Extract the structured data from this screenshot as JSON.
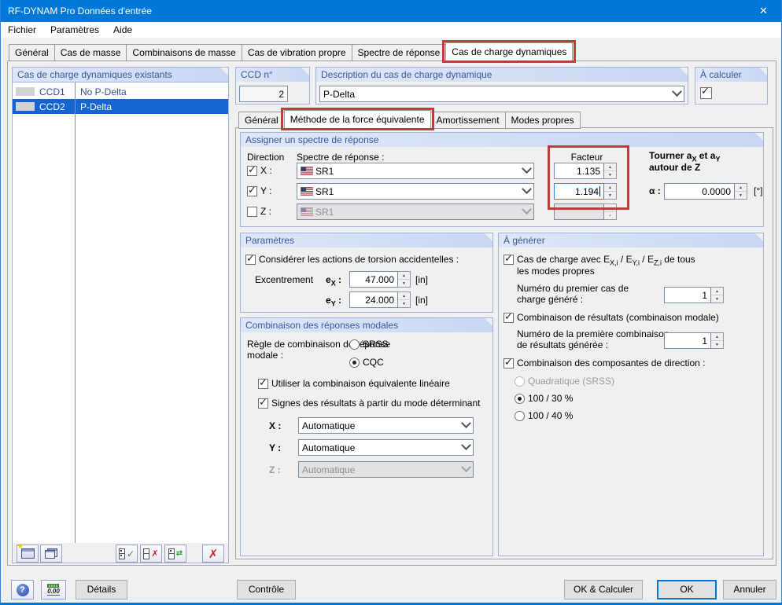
{
  "window": {
    "title": "RF-DYNAM Pro Données d'entrée",
    "close_glyph": "✕"
  },
  "menu": {
    "items": [
      "Fichier",
      "Paramètres",
      "Aide"
    ]
  },
  "tabs": {
    "items": [
      "Général",
      "Cas de masse",
      "Combinaisons de masse",
      "Cas de vibration propre",
      "Spectre de réponse",
      "Cas de charge dynamiques"
    ],
    "active": "Cas de charge dynamiques"
  },
  "existing": {
    "header": "Cas de charge dynamiques existants",
    "rows": [
      {
        "id": "CCD1",
        "desc": "No P-Delta",
        "selected": false
      },
      {
        "id": "CCD2",
        "desc": "P-Delta",
        "selected": true
      }
    ],
    "toolbar_icons": [
      "new-case-icon",
      "copy-case-icon",
      "select-all-icon",
      "deselect-all-icon",
      "invert-selection-icon",
      "delete-case-icon"
    ]
  },
  "ccd": {
    "header": "CCD n°",
    "value": "2"
  },
  "description": {
    "header": "Description du cas de charge dynamique",
    "value": "P-Delta"
  },
  "calculate": {
    "header": "À calculer",
    "checked": true
  },
  "inner_tabs": {
    "items": [
      "Général",
      "Méthode de la force équivalente",
      "Amortissement",
      "Modes propres"
    ],
    "active": "Méthode de la force équivalente"
  },
  "assign": {
    "header": "Assigner un spectre de réponse",
    "direction_label": "Direction",
    "spectrum_label": "Spectre de réponse :",
    "factor_label": "Facteur",
    "rotate": {
      "p1": "Tourner a",
      "s1": "X",
      "p2": " et a",
      "s2": "Y",
      "line2": "autour de Z"
    },
    "alpha": {
      "label": "α :",
      "value": "0.0000",
      "unit": "[°]"
    },
    "rows": [
      {
        "axis": "X :",
        "checked": true,
        "spectrum": "SR1",
        "factor": "1.135",
        "focused": false,
        "disabled": false
      },
      {
        "axis": "Y :",
        "checked": true,
        "spectrum": "SR1",
        "factor": "1.194",
        "focused": true,
        "disabled": false
      },
      {
        "axis": "Z :",
        "checked": false,
        "spectrum": "SR1",
        "factor": "",
        "focused": false,
        "disabled": true
      }
    ]
  },
  "params": {
    "header": "Paramètres",
    "torsion_label": "Considérer les actions de torsion accidentelles :",
    "torsion_checked": true,
    "ecc_label": "Excentrement",
    "ex": {
      "base": "e",
      "sub": "X",
      "sep": " :",
      "value": "47.000",
      "unit": "[in]"
    },
    "ey": {
      "base": "e",
      "sub": "Y",
      "sep": " :",
      "value": "24.000",
      "unit": "[in]"
    }
  },
  "modal": {
    "header": "Combinaison des réponses modales",
    "rule_l1": "Règle de combinaison de réponse",
    "rule_l2": "modale :",
    "srss_label": "SRSS",
    "srss_selected": false,
    "cqc_label": "CQC",
    "cqc_selected": true,
    "linear_label": "Utiliser la combinaison équivalente linéaire",
    "linear_checked": true,
    "signs_label": "Signes des résultats à partir du mode déterminant",
    "signs_checked": true,
    "combos": [
      {
        "axis": "X :",
        "value": "Automatique",
        "disabled": false
      },
      {
        "axis": "Y :",
        "value": "Automatique",
        "disabled": false
      },
      {
        "axis": "Z :",
        "value": "Automatique",
        "disabled": true
      }
    ]
  },
  "generate": {
    "header": "À générer",
    "lc": {
      "checked": true,
      "p1": "Cas de charge avec E",
      "s1": "X,i",
      "p2": " / E",
      "s2": "Y,i",
      "p3": " / E",
      "s3": "Z,i",
      "p4": " de tous",
      "line2": "les modes propres"
    },
    "first_lc": {
      "l1": "Numéro du premier cas de",
      "l2": "charge généré :",
      "value": "1"
    },
    "rc_label": "Combinaison de résultats (combinaison modale)",
    "rc_checked": true,
    "first_rc": {
      "l1": "Numéro de la première combinaison",
      "l2": "de résultats générée :",
      "value": "1"
    },
    "dir_label": "Combinaison des composantes de direction :",
    "dir_checked": true,
    "options": [
      {
        "label": "Quadratique (SRSS)",
        "selected": false,
        "disabled": true
      },
      {
        "label": "100 / 30 %",
        "selected": true,
        "disabled": false
      },
      {
        "label": "100 / 40 %",
        "selected": false,
        "disabled": false
      }
    ]
  },
  "footer": {
    "help_label": "?",
    "units_label": "0.00",
    "details": "Détails",
    "control": "Contrôle",
    "ok_calc": "OK & Calculer",
    "ok": "OK",
    "cancel": "Annuler"
  },
  "colors": {
    "titlebar": "#0078d7",
    "selection": "#1464d2",
    "annotation": "#c23b3b",
    "header_text": "#3a5698"
  }
}
